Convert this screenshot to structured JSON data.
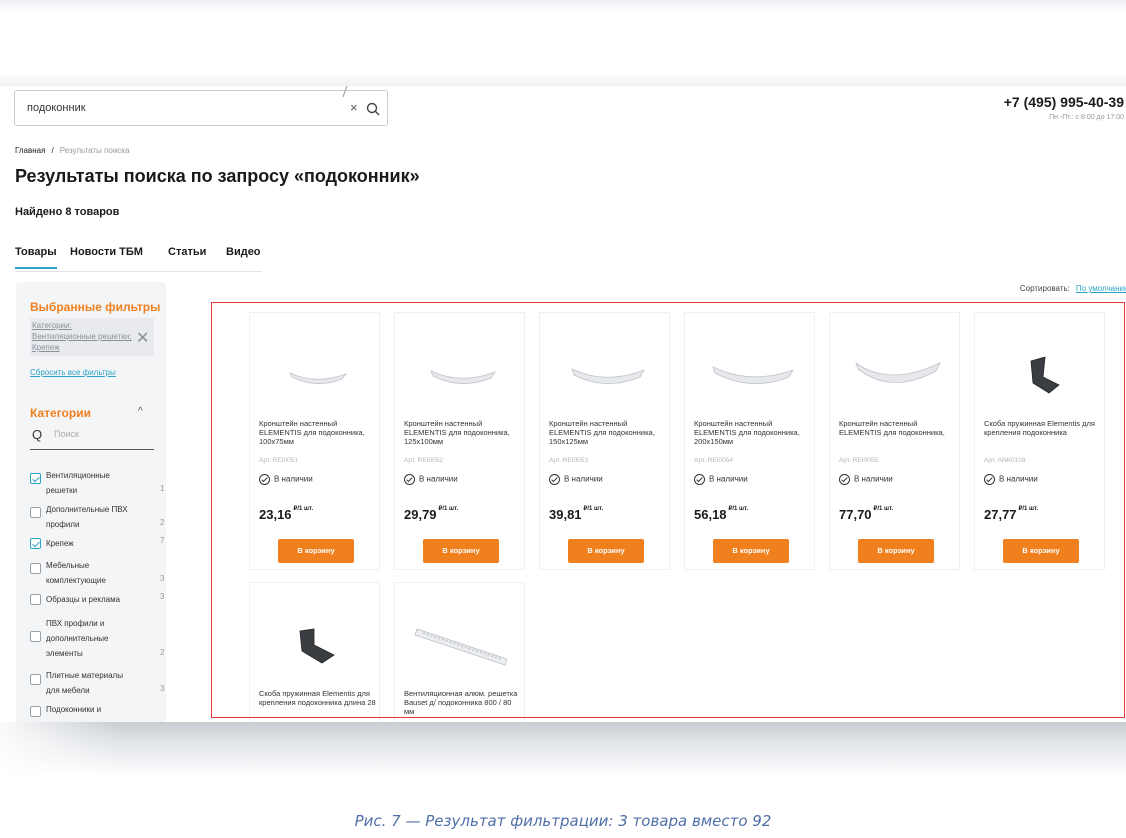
{
  "search": {
    "value": "подоконник"
  },
  "header": {
    "phone": "+7 (495) 995-40-39",
    "hours": "Пн.-Пт.: с 8:00 до 17:00"
  },
  "breadcrumb": {
    "home": "Главная",
    "separator": "/",
    "current": "Результаты поиска"
  },
  "page_title": "Результаты поиска по запросу «подоконник»",
  "found_text": "Найдено 8 товаров",
  "tabs": [
    {
      "label": "Товары",
      "active": true
    },
    {
      "label": "Новости ТБМ"
    },
    {
      "label": "Статьи"
    },
    {
      "label": "Видео"
    }
  ],
  "sort": {
    "label": "Сортировать:",
    "value": "По умолчанию"
  },
  "sidebar": {
    "selected_title": "Выбранные фильтры",
    "chip": "Категории: Вентиляционные решетки; Крепеж",
    "reset": "Сбросить все фильтры",
    "categories_title": "Категории",
    "search_placeholder": "Поиск",
    "categories": [
      {
        "label": "Вентиляционные решетки",
        "count": "1",
        "checked": true
      },
      {
        "label": "Дополнительные ПВХ профили",
        "count": "2",
        "checked": false
      },
      {
        "label": "Крепеж",
        "count": "7",
        "checked": true
      },
      {
        "label": "Мебельные комплектующие",
        "count": "3",
        "checked": false
      },
      {
        "label": "Образцы и реклама",
        "count": "3",
        "checked": false
      },
      {
        "label": "ПВХ профили и дополнительные элементы",
        "count": "2",
        "checked": false
      },
      {
        "label": "Плитные материалы для мебели",
        "count": "3",
        "checked": false
      },
      {
        "label": "Подоконники и",
        "count": "",
        "checked": false
      }
    ]
  },
  "products": [
    {
      "name": "Кронштейн настенный ELEMENTIS для подоконника, 100х75мм",
      "art": "Арт. REI0051",
      "stock": "В наличии",
      "price": "23,16",
      "unit": "₽/1 шт.",
      "buy": "В корзину",
      "image": "bracket"
    },
    {
      "name": "Кронштейн настенный ELEMENTIS для подоконника, 125х100мм",
      "art": "Арт. REI0052",
      "stock": "В наличии",
      "price": "29,79",
      "unit": "₽/1 шт.",
      "buy": "В корзину",
      "image": "bracket"
    },
    {
      "name": "Кронштейн настенный ELEMENTIS для подоконника, 150х125мм",
      "art": "Арт. REI0053",
      "stock": "В наличии",
      "price": "39,81",
      "unit": "₽/1 шт.",
      "buy": "В корзину",
      "image": "bracket"
    },
    {
      "name": "Кронштейн настенный ELEMENTIS для подоконника, 200х150мм",
      "art": "Арт. REI0054",
      "stock": "В наличии",
      "price": "56,18",
      "unit": "₽/1 шт.",
      "buy": "В корзину",
      "image": "bracket"
    },
    {
      "name": "Кронштейн настенный ELEMENTIS для подоконника,",
      "art": "Арт. REI0055",
      "stock": "В наличии",
      "price": "77,70",
      "unit": "₽/1 шт.",
      "buy": "В корзину",
      "image": "bracket"
    },
    {
      "name": "Скоба пружинная Elementis для крепления подоконника",
      "art": "Арт. ANK0109",
      "stock": "В наличии",
      "price": "27,77",
      "unit": "₽/1 шт.",
      "buy": "В корзину",
      "image": "clip"
    },
    {
      "name": "Скоба пружинная Elementis для крепления подоконника длина 28",
      "image": "clip"
    },
    {
      "name": "Вентиляционная алюм. решетка Bauset д/ подоконника 800 / 80 мм",
      "image": "grille"
    }
  ],
  "caption": "Рис. 7 — Результат фильтрации: 3 товара вместо 92",
  "colors": {
    "accent_orange": "#f07f1e",
    "link_blue": "#2aa3c8",
    "highlight_red": "#e53935",
    "caption_blue": "#4f6fa8"
  }
}
